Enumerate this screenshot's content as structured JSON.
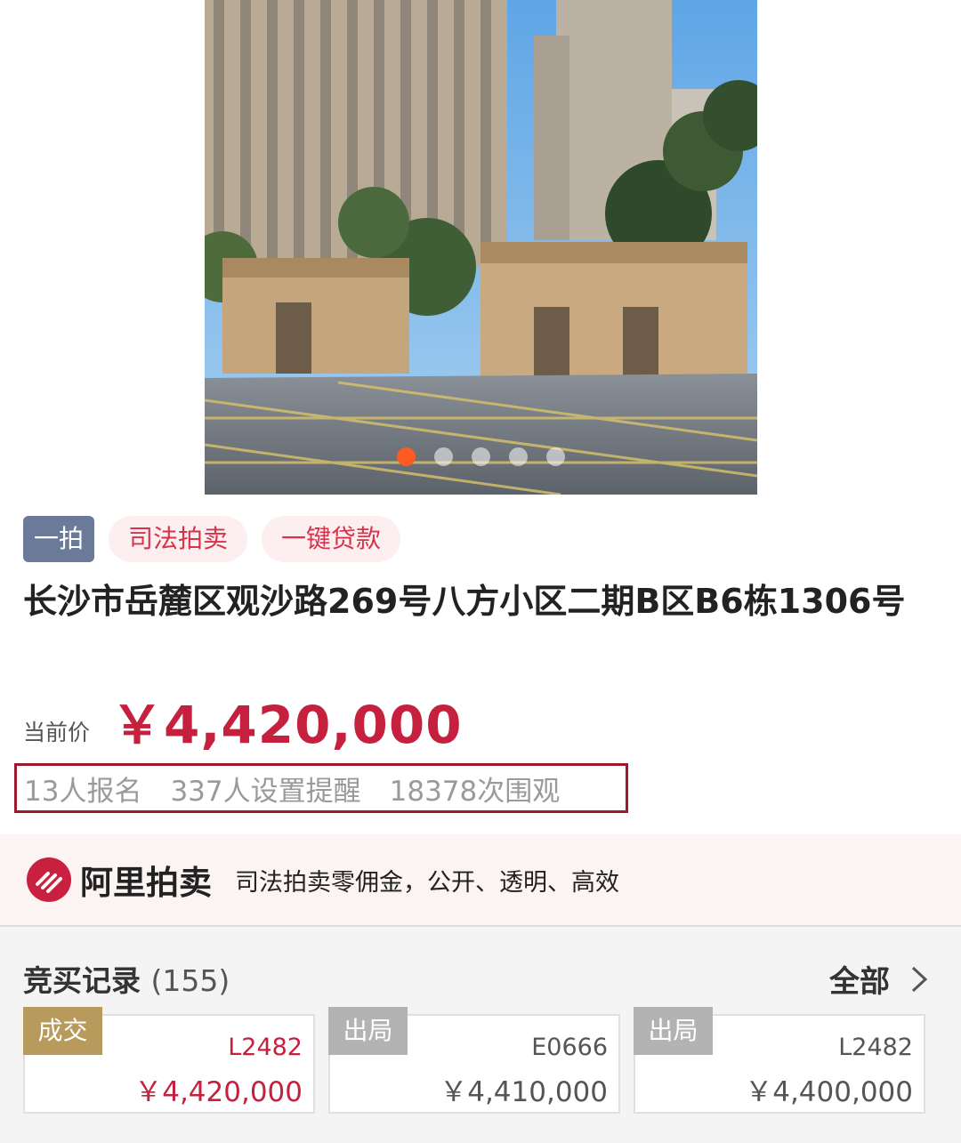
{
  "carousel": {
    "slide_count": 5,
    "active_index": 0,
    "active_color": "#ff5a1f"
  },
  "tags": [
    "一拍",
    "司法拍卖",
    "一键贷款"
  ],
  "title": "长沙市岳麓区观沙路269号八方小区二期B区B6栋1306号",
  "price": {
    "label": "当前价",
    "value": "￥4,420,000",
    "color": "#c5203e"
  },
  "stats": {
    "signups": "13人报名",
    "reminders": "337人设置提醒",
    "views": "18378次围观"
  },
  "banner": {
    "brand": "阿里拍卖",
    "slogan": "司法拍卖零佣金，公开、透明、高效",
    "logo_icon": "ali-auction-logo-icon"
  },
  "records": {
    "title": "竞买记录",
    "count": "(155)",
    "all_label": "全部",
    "items": [
      {
        "status": "成交",
        "code": "L2482",
        "price": "￥4,420,000"
      },
      {
        "status": "出局",
        "code": "E0666",
        "price": "￥4,410,000"
      },
      {
        "status": "出局",
        "code": "L2482",
        "price": "￥4,400,000"
      }
    ]
  }
}
